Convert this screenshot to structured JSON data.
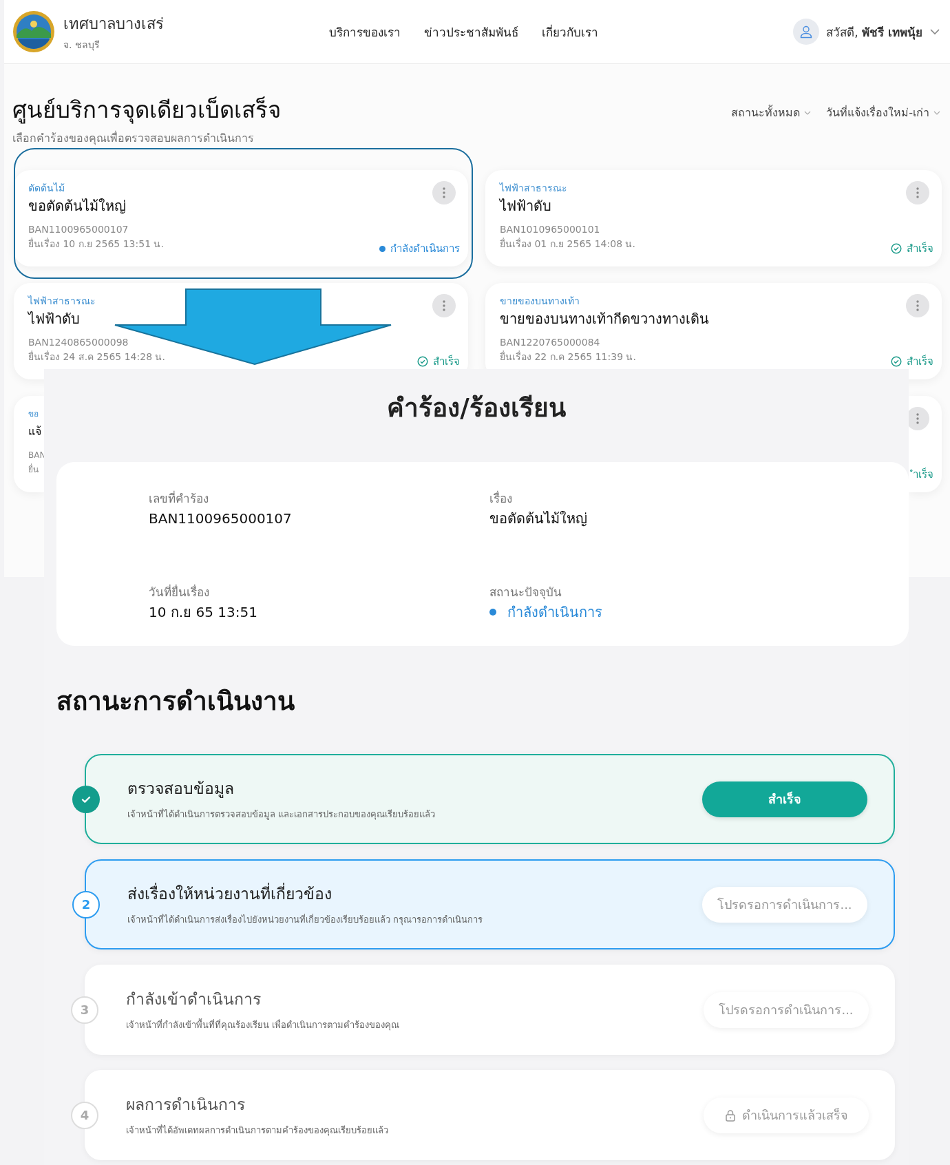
{
  "header": {
    "org_name": "เทศบาลบางเสร่",
    "org_province": "จ. ชลบุรี",
    "nav": [
      {
        "label": "บริการของเรา"
      },
      {
        "label": "ข่าวประชาสัมพันธ์"
      },
      {
        "label": "เกี่ยวกับเรา"
      }
    ],
    "user_greeting": "สวัสดี, **พัชรี เทพนุ้ย**"
  },
  "page": {
    "title": "ศูนย์บริการจุดเดียวเบ็ดเสร็จ",
    "subtitle": "เลือกคำร้องของคุณเพื่อตรวจสอบผลการดำเนินการ",
    "filters": [
      {
        "label": "สถานะทั้งหมด"
      },
      {
        "label": "วันที่แจ้งเรื่องใหม่-เก่า"
      }
    ]
  },
  "cards": [
    {
      "kind": "full",
      "category": "ตัดต้นไม้",
      "title": "ขอตัดต้นไม้ใหญ่",
      "request_id": "BAN1100965000107",
      "date": "ยื่นเรื่อง 10 ก.ย 2565 13:51 น.",
      "highlighted": true,
      "status": {
        "kind": "in_progress",
        "text": "กำลังดำเนินการ"
      }
    },
    {
      "kind": "full",
      "category": "ไฟฟ้าสาธารณะ",
      "title": "ไฟฟ้าดับ",
      "request_id": "BAN1010965000101",
      "date": "ยื่นเรื่อง 01 ก.ย 2565 14:08 น.",
      "highlighted": false,
      "status": {
        "kind": "done",
        "text": "สำเร็จ"
      }
    },
    {
      "kind": "full",
      "category": "ไฟฟ้าสาธารณะ",
      "title": "ไฟฟ้าดับ",
      "request_id": "BAN1240865000098",
      "date": "ยื่นเรื่อง 24 ส.ค 2565 14:28 น.",
      "highlighted": false,
      "status": {
        "kind": "done",
        "text": "สำเร็จ"
      }
    },
    {
      "kind": "full",
      "category": "ขายของบนทางเท้า",
      "title": "ขายของบนทางเท้ากีดขวางทางเดิน",
      "request_id": "BAN1220765000084",
      "date": "ยื่นเรื่อง 22 ก.ค 2565 11:39 น.",
      "highlighted": false,
      "status": {
        "kind": "done",
        "text": "สำเร็จ"
      }
    },
    {
      "kind": "cut_left",
      "category": "ขอ",
      "title": "แจ้",
      "request_id": "BAN",
      "date": "ยื่น",
      "highlighted": false
    },
    {
      "kind": "cut_right",
      "highlighted": false,
      "status": {
        "kind": "text_only",
        "text": "ำเร็จ"
      }
    }
  ],
  "detail": {
    "title": "คำร้อง/ร้องเรียน",
    "fields": [
      {
        "kind": "text",
        "label": "เลขที่คำร้อง",
        "value": "BAN1100965000107"
      },
      {
        "kind": "text",
        "label": "เรื่อง",
        "value": "ขอตัดต้นไม้ใหญ่"
      },
      {
        "kind": "text",
        "label": "วันที่ยื่นเรื่อง",
        "value": "10 ก.ย 65 13:51"
      },
      {
        "kind": "status",
        "label": "สถานะปัจจุบัน",
        "value": "กำลังดำเนินการ"
      }
    ],
    "progress_title": "สถานะการดำเนินงาน",
    "steps": [
      {
        "kind": "done",
        "title": "ตรวจสอบข้อมูล",
        "description": "เจ้าหน้าที่ได้ดำเนินการตรวจสอบข้อมูล และเอกสารประกอบของคุณเรียบร้อยแล้ว",
        "button": "สำเร็จ"
      },
      {
        "kind": "current",
        "number": "2",
        "title": "ส่งเรื่องให้หน่วยงานที่เกี่ยวข้อง",
        "description": "เจ้าหน้าที่ได้ดำเนินการส่งเรื่องไปยังหน่วยงานที่เกี่ยวข้องเรียบร้อยแล้ว กรุณารอการดำเนินการ",
        "button": "โปรดรอการดำเนินการ..."
      },
      {
        "kind": "pending",
        "number": "3",
        "title": "กำลังเข้าดำเนินการ",
        "description": "เจ้าหน้าที่กำลังเข้าพื้นที่ที่คุณร้องเรียน เพื่อดำเนินการตามคำร้องของคุณ",
        "button": "โปรดรอการดำเนินการ..."
      },
      {
        "kind": "locked",
        "number": "4",
        "title": "ผลการดำเนินการ",
        "description": "เจ้าหน้าที่ได้อัพเดทผลการดำเนินการตามคำร้องของคุณเรียบร้อยแล้ว",
        "button": "ดำเนินการแล้วเสร็จ"
      }
    ]
  }
}
